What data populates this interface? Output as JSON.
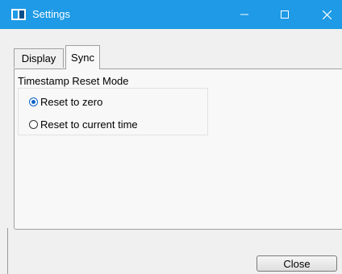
{
  "window": {
    "title": "Settings",
    "titlebar_color": "#1e9ae6",
    "controls": [
      "minimize-icon",
      "maximize-icon",
      "close-icon"
    ]
  },
  "tabs": [
    {
      "label": "Display",
      "selected": false
    },
    {
      "label": "Sync",
      "selected": true
    }
  ],
  "sync": {
    "group_label": "Timestamp Reset Mode",
    "options": [
      {
        "label": "Reset to zero",
        "checked": true
      },
      {
        "label": "Reset to current time",
        "checked": false
      }
    ]
  },
  "footer": {
    "close_label": "Close"
  }
}
